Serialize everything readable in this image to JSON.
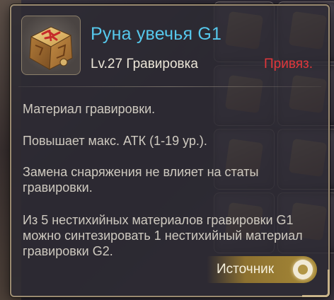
{
  "item": {
    "name": "Руна увечья G1",
    "level_type": "Lv.27 Гравировка",
    "bound": "Привяз.",
    "icon": "engraving-rune-icon"
  },
  "description": {
    "line1": "Материал гравировки.",
    "line2": "Повышает макс. АТК (1-19 ур.).",
    "line3": "Замена снаряжения не влияет на статы гравировки.",
    "line4": "Из 5 нестихийных материалов гравировки G1 можно синтезировать 1 нестихийный материал гравировки G2."
  },
  "actions": {
    "source_label": "Источник",
    "source_icon": "target-icon"
  },
  "colors": {
    "title": "#56c8ec",
    "bound": "#e0373b",
    "button": "#a78936"
  }
}
